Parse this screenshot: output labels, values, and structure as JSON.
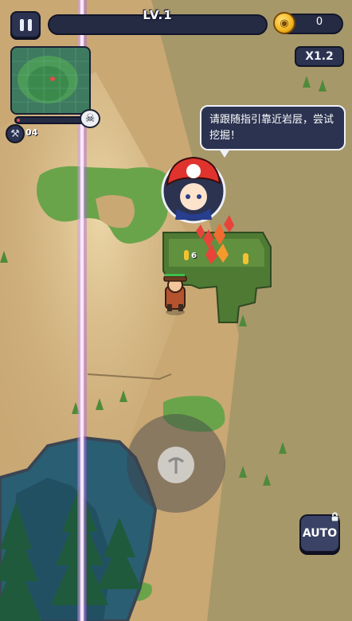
{
  "hud": {
    "level_label": "LV.1",
    "xp_progress": 0.0,
    "coin_count": "0",
    "coin_icon": "coin-icon",
    "speed_label": "X1.2",
    "minimap_enemy_badge": "skull-icon",
    "mine_progress": 0.05,
    "hammer_count": "04",
    "auto_label": "AUTO",
    "auto_locked": true
  },
  "tutorial": {
    "speech_text": "请跟随指引靠近岩层，尝试挖掘！",
    "guide_name": "guide-girl"
  },
  "world": {
    "damage_number": "6",
    "joystick_icon": "pickaxe-icon"
  },
  "colors": {
    "sand": "#c9a874",
    "grass": "#6aa44a",
    "rock_moss": "#5b8a3a",
    "water": "#2a5e73",
    "laser": "#b06ad8",
    "hud_panel": "#2b3350",
    "xp_fill": "#5f7bd8"
  }
}
